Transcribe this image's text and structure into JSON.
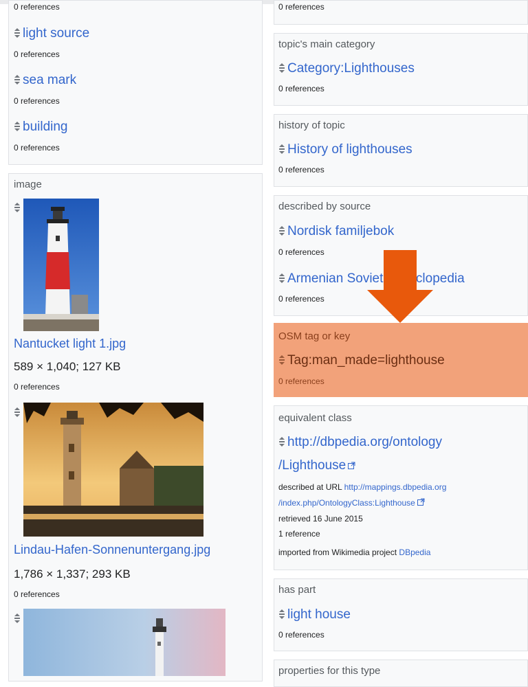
{
  "left": {
    "top_refs": "0 references",
    "instance_values": [
      {
        "label": "light source",
        "refs": "0 references"
      },
      {
        "label": "sea mark",
        "refs": "0 references"
      },
      {
        "label": "building",
        "refs": "0 references"
      }
    ],
    "image_property": "image",
    "images": [
      {
        "filename": "Nantucket light 1.jpg",
        "dims": "589 × 1,040; 127 KB",
        "refs": "0 references"
      },
      {
        "filename": "Lindau-Hafen-Sonnenuntergang.jpg",
        "dims": "1,786 × 1,337; 293 KB",
        "refs": "0 references"
      }
    ]
  },
  "right": {
    "top_refs": "0 references",
    "main_category": {
      "label": "topic's main category",
      "value": "Category:Lighthouses",
      "refs": "0 references"
    },
    "history": {
      "label": "history of topic",
      "value": "History of lighthouses",
      "refs": "0 references"
    },
    "described_by": {
      "label": "described by source",
      "values": [
        {
          "value": "Nordisk familjebok",
          "refs": "0 references"
        },
        {
          "value": "Armenian Soviet Encyclopedia",
          "refs": "0 references"
        }
      ]
    },
    "osm": {
      "label": "OSM tag or key",
      "value": "Tag:man_made=lighthouse",
      "refs": "0 references"
    },
    "equivalent": {
      "label": "equivalent class",
      "value_line1": "http://dbpedia.org/ontology",
      "value_line2": "/Lighthouse",
      "described_prefix": "described at URL",
      "described_url1": "http://mappings.dbpedia.org",
      "described_url2": "/index.php/OntologyClass:Lighthouse",
      "retrieved_prefix": "retrieved",
      "retrieved_date": "16 June 2015",
      "refs": "1 reference",
      "imported_prefix": "imported from Wikimedia project",
      "imported_project": "DBpedia"
    },
    "has_part": {
      "label": "has part",
      "value": "light house",
      "refs": "0 references"
    },
    "properties_label": "properties for this type"
  },
  "colors": {
    "link": "#3366cc",
    "highlight": "#f2a27a",
    "arrow": "#e8590c",
    "osm_text": "#6b2e12"
  }
}
